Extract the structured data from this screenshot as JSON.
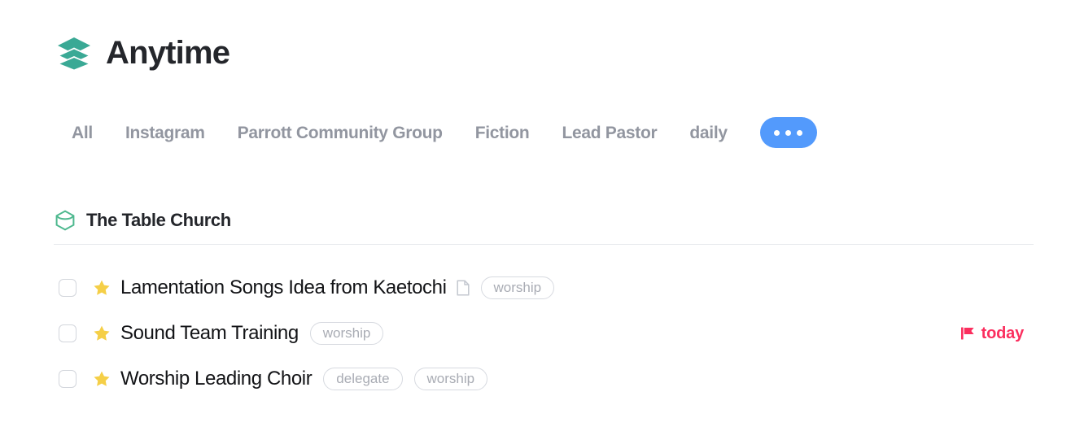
{
  "header": {
    "title": "Anytime",
    "logo_icon": "layers-stack-icon",
    "logo_color": "#3aa995"
  },
  "tabs": {
    "items": [
      {
        "label": "All"
      },
      {
        "label": "Instagram"
      },
      {
        "label": "Parrott Community Group"
      },
      {
        "label": "Fiction"
      },
      {
        "label": "Lead Pastor"
      },
      {
        "label": "daily"
      }
    ],
    "more_button": {
      "icon": "ellipsis-icon",
      "color": "#539afc"
    }
  },
  "group": {
    "icon": "hexagon-box-icon",
    "icon_color": "#4db88e",
    "title": "The Table Church"
  },
  "tasks": [
    {
      "checkbox_checked": false,
      "star_icon": "star-icon",
      "title": "Lamentation Songs Idea from Kaetochi",
      "has_note": true,
      "note_icon": "document-icon",
      "tags": [
        "worship"
      ],
      "due": null
    },
    {
      "checkbox_checked": false,
      "star_icon": "star-icon",
      "title": "Sound Team Training",
      "has_note": false,
      "note_icon": "document-icon",
      "tags": [
        "worship"
      ],
      "due": {
        "label": "today",
        "icon": "flag-icon",
        "color": "#fb2e5e"
      }
    },
    {
      "checkbox_checked": false,
      "star_icon": "star-icon",
      "title": "Worship Leading Choir",
      "has_note": false,
      "note_icon": "document-icon",
      "tags": [
        "delegate",
        "worship"
      ],
      "due": null
    }
  ],
  "colors": {
    "accent_blue": "#539afc",
    "star_yellow": "#f5cf47",
    "teal": "#3aa995",
    "green": "#4db88e",
    "due_red": "#fb2e5e",
    "text_dark": "#24262b",
    "text_muted": "#9296a0",
    "tag_border": "#d7dae0",
    "divider": "#e7e9ed"
  }
}
